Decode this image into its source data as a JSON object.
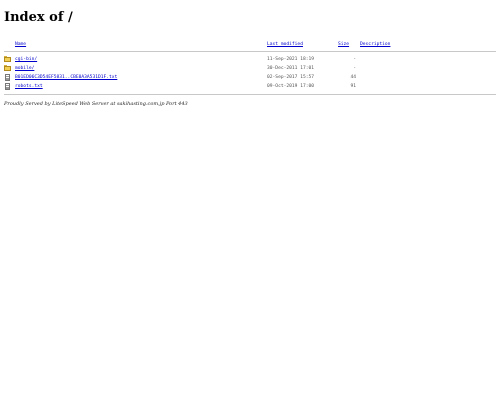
{
  "page": {
    "title": "Index of /"
  },
  "columns": {
    "name": "Name",
    "last_modified": "Last modified",
    "size": "Size",
    "description": "Description"
  },
  "entries": [
    {
      "icon": "folder-icon",
      "name": "cgi-bin/",
      "modified": "11-Sep-2021 18:19",
      "size": "-",
      "description": ""
    },
    {
      "icon": "folder-icon",
      "name": "mobile/",
      "modified": "30-Dec-2011 17:01",
      "size": "-",
      "description": ""
    },
    {
      "icon": "file-icon",
      "name": "B01ED06C3D54EF5831..CBE0A3A531D1F.txt",
      "modified": "02-Sep-2017 15:57",
      "size": "44",
      "description": ""
    },
    {
      "icon": "file-icon",
      "name": "robots.txt",
      "modified": "09-Oct-2019 17:00",
      "size": "91",
      "description": ""
    }
  ],
  "footer": {
    "text": "Proudly Served by LiteSpeed Web Server at sakihasting.com.jp Port 443"
  }
}
